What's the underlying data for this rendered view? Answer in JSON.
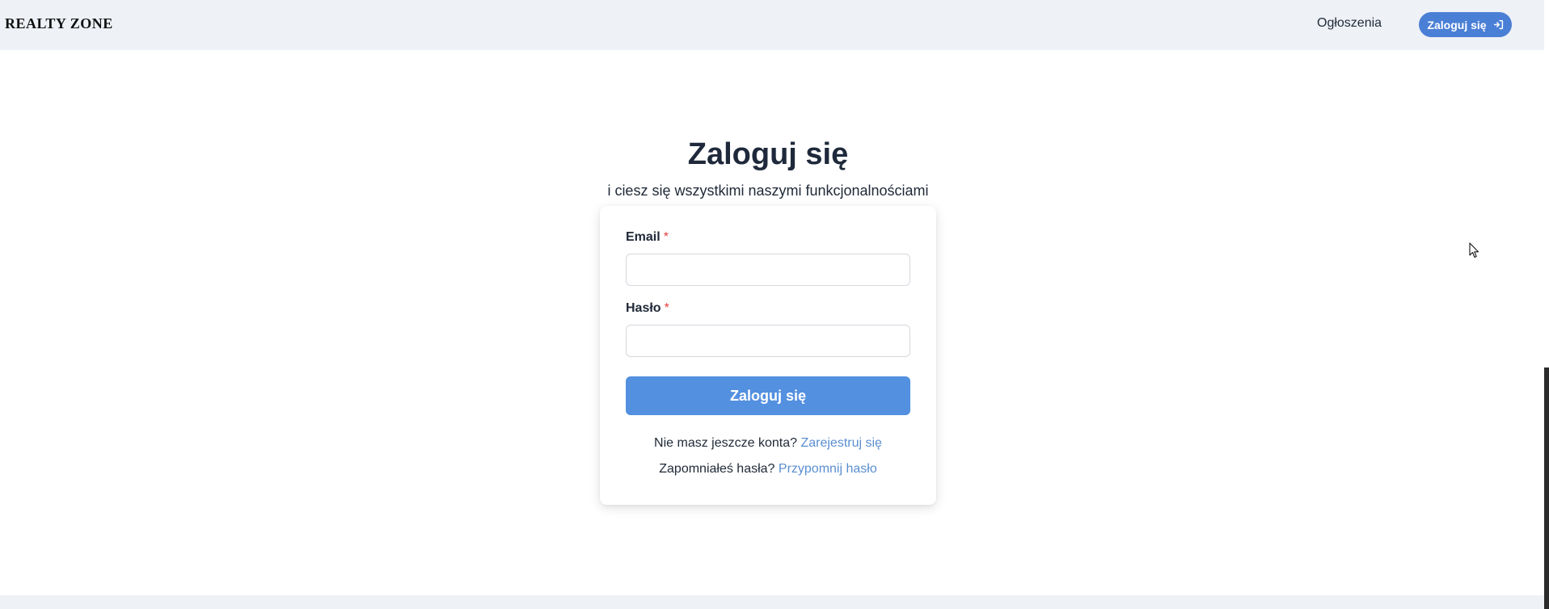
{
  "header": {
    "logo": "REALTY ZONE",
    "nav_link": "Ogłoszenia",
    "login_button": "Zaloguj się",
    "login_icon": "sign-in-icon"
  },
  "main": {
    "title": "Zaloguj się",
    "subtitle": "i ciesz się wszystkimi naszymi funkcjonalnościami"
  },
  "form": {
    "email_label": "Email",
    "email_value": "",
    "password_label": "Hasło",
    "password_value": "",
    "required_mark": "*",
    "submit_label": "Zaloguj się",
    "register_prompt": "Nie masz jeszcze konta?",
    "register_link": "Zarejestruj się",
    "forgot_prompt": "Zapomniałeś hasła?",
    "forgot_link": "Przypomnij hasło"
  },
  "colors": {
    "topbar_bg": "#eef1f6",
    "accent": "#5390e0",
    "nav_button": "#4a7fd6",
    "link": "#5b8fd0",
    "required": "#e53e3e"
  }
}
